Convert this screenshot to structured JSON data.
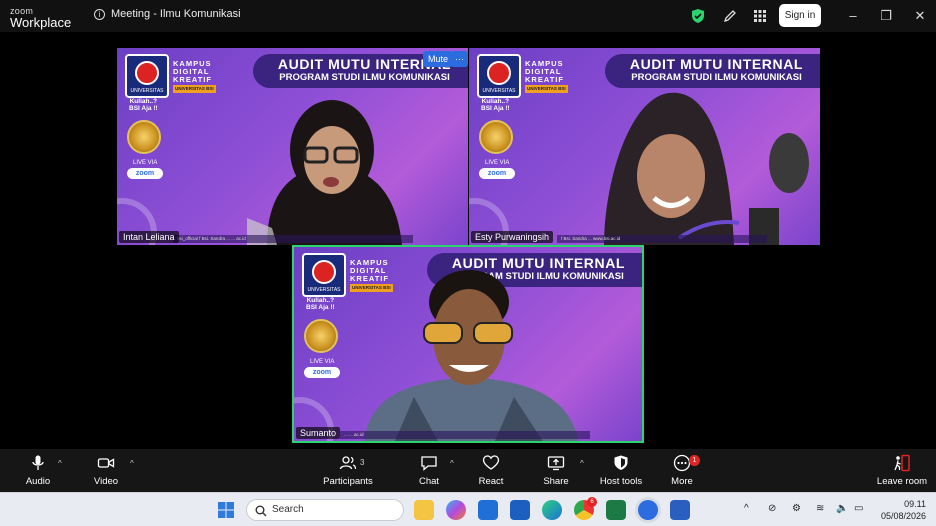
{
  "titlebar": {
    "brand_top": "zoom",
    "brand_bottom": "Workplace",
    "meeting_title": "Meeting - Ilmu Komunikasi",
    "signin_label": "Sign in",
    "icons": [
      "shield-check-icon",
      "pen-icon",
      "grid-apps-icon"
    ],
    "window_controls": [
      "minimize-icon",
      "restore-icon",
      "close-icon"
    ]
  },
  "tiles": [
    {
      "participant_name": "Intan Leliana",
      "banner_line1": "AUDIT MUTU INTERNAL",
      "banner_line2": "PROGRAM STUDI ILMU KOMUNIKASI",
      "kampus": [
        "KAMPUS",
        "DIGITAL",
        "KREATIF"
      ],
      "kampus_tag": "UNIVERSITAS BSI",
      "logo_text": "UNIVERSITAS",
      "kuliah": [
        "Kuliah..?",
        "BSI Aja !!"
      ],
      "live_via": "LIVE VIA",
      "zoom": "zoom",
      "footer": "bsi_official   f Bsi. Sandra  ...   ...   ac.id",
      "hover_mute": "Mute",
      "hover_more": "···"
    },
    {
      "participant_name": "Esty Purwaningsih",
      "banner_line1": "AUDIT MUTU INTERNAL",
      "banner_line2": "PROGRAM STUDI ILMU KOMUNIKASI",
      "kampus": [
        "KAMPUS",
        "DIGITAL",
        "KREATIF"
      ],
      "kampus_tag": "UNIVERSITAS BSI",
      "logo_text": "UNIVERSITAS",
      "kuliah": [
        "Kuliah..?",
        "BSI Aja !!"
      ],
      "live_via": "LIVE VIA",
      "zoom": "zoom",
      "footer": "f Bsi. Sandra   ...   www.bsi.ac.id"
    },
    {
      "participant_name": "Sumanto",
      "banner_line1": "AUDIT MUTU INTERNAL",
      "banner_line2": "PROGRAM STUDI ILMU KOMUNIKASI",
      "kampus": [
        "KAMPUS",
        "DIGITAL",
        "KREATIF"
      ],
      "kampus_tag": "UNIVERSITAS BSI",
      "logo_text": "UNIVERSITAS",
      "kuliah": [
        "Kuliah..?",
        "BSI Aja !!"
      ],
      "live_via": "LIVE VIA",
      "zoom": "zoom",
      "footer": "...   ...   ac.id"
    }
  ],
  "toolbar": {
    "audio": "Audio",
    "video": "Video",
    "participants": "Participants",
    "participants_count": "3",
    "chat": "Chat",
    "react": "React",
    "share": "Share",
    "host_tools": "Host tools",
    "more": "More",
    "more_badge": "1",
    "leave": "Leave room"
  },
  "taskbar": {
    "search_placeholder": "Search",
    "apps": [
      "windows-start-icon",
      "file-explorer-icon",
      "copilot-icon",
      "mail-icon",
      "store-icon",
      "edge-icon",
      "chrome-icon",
      "excel-icon",
      "zoom-app-icon",
      "word-icon"
    ],
    "chrome_badge": "6",
    "time": "09.11",
    "date": "05/08/2026"
  },
  "colors": {
    "accent_green": "#2dd36f",
    "signin_bg": "#ffffff",
    "tile_purple": "#8e4fd6",
    "banner_navy": "#3b2480",
    "notification_red": "#e02424"
  }
}
